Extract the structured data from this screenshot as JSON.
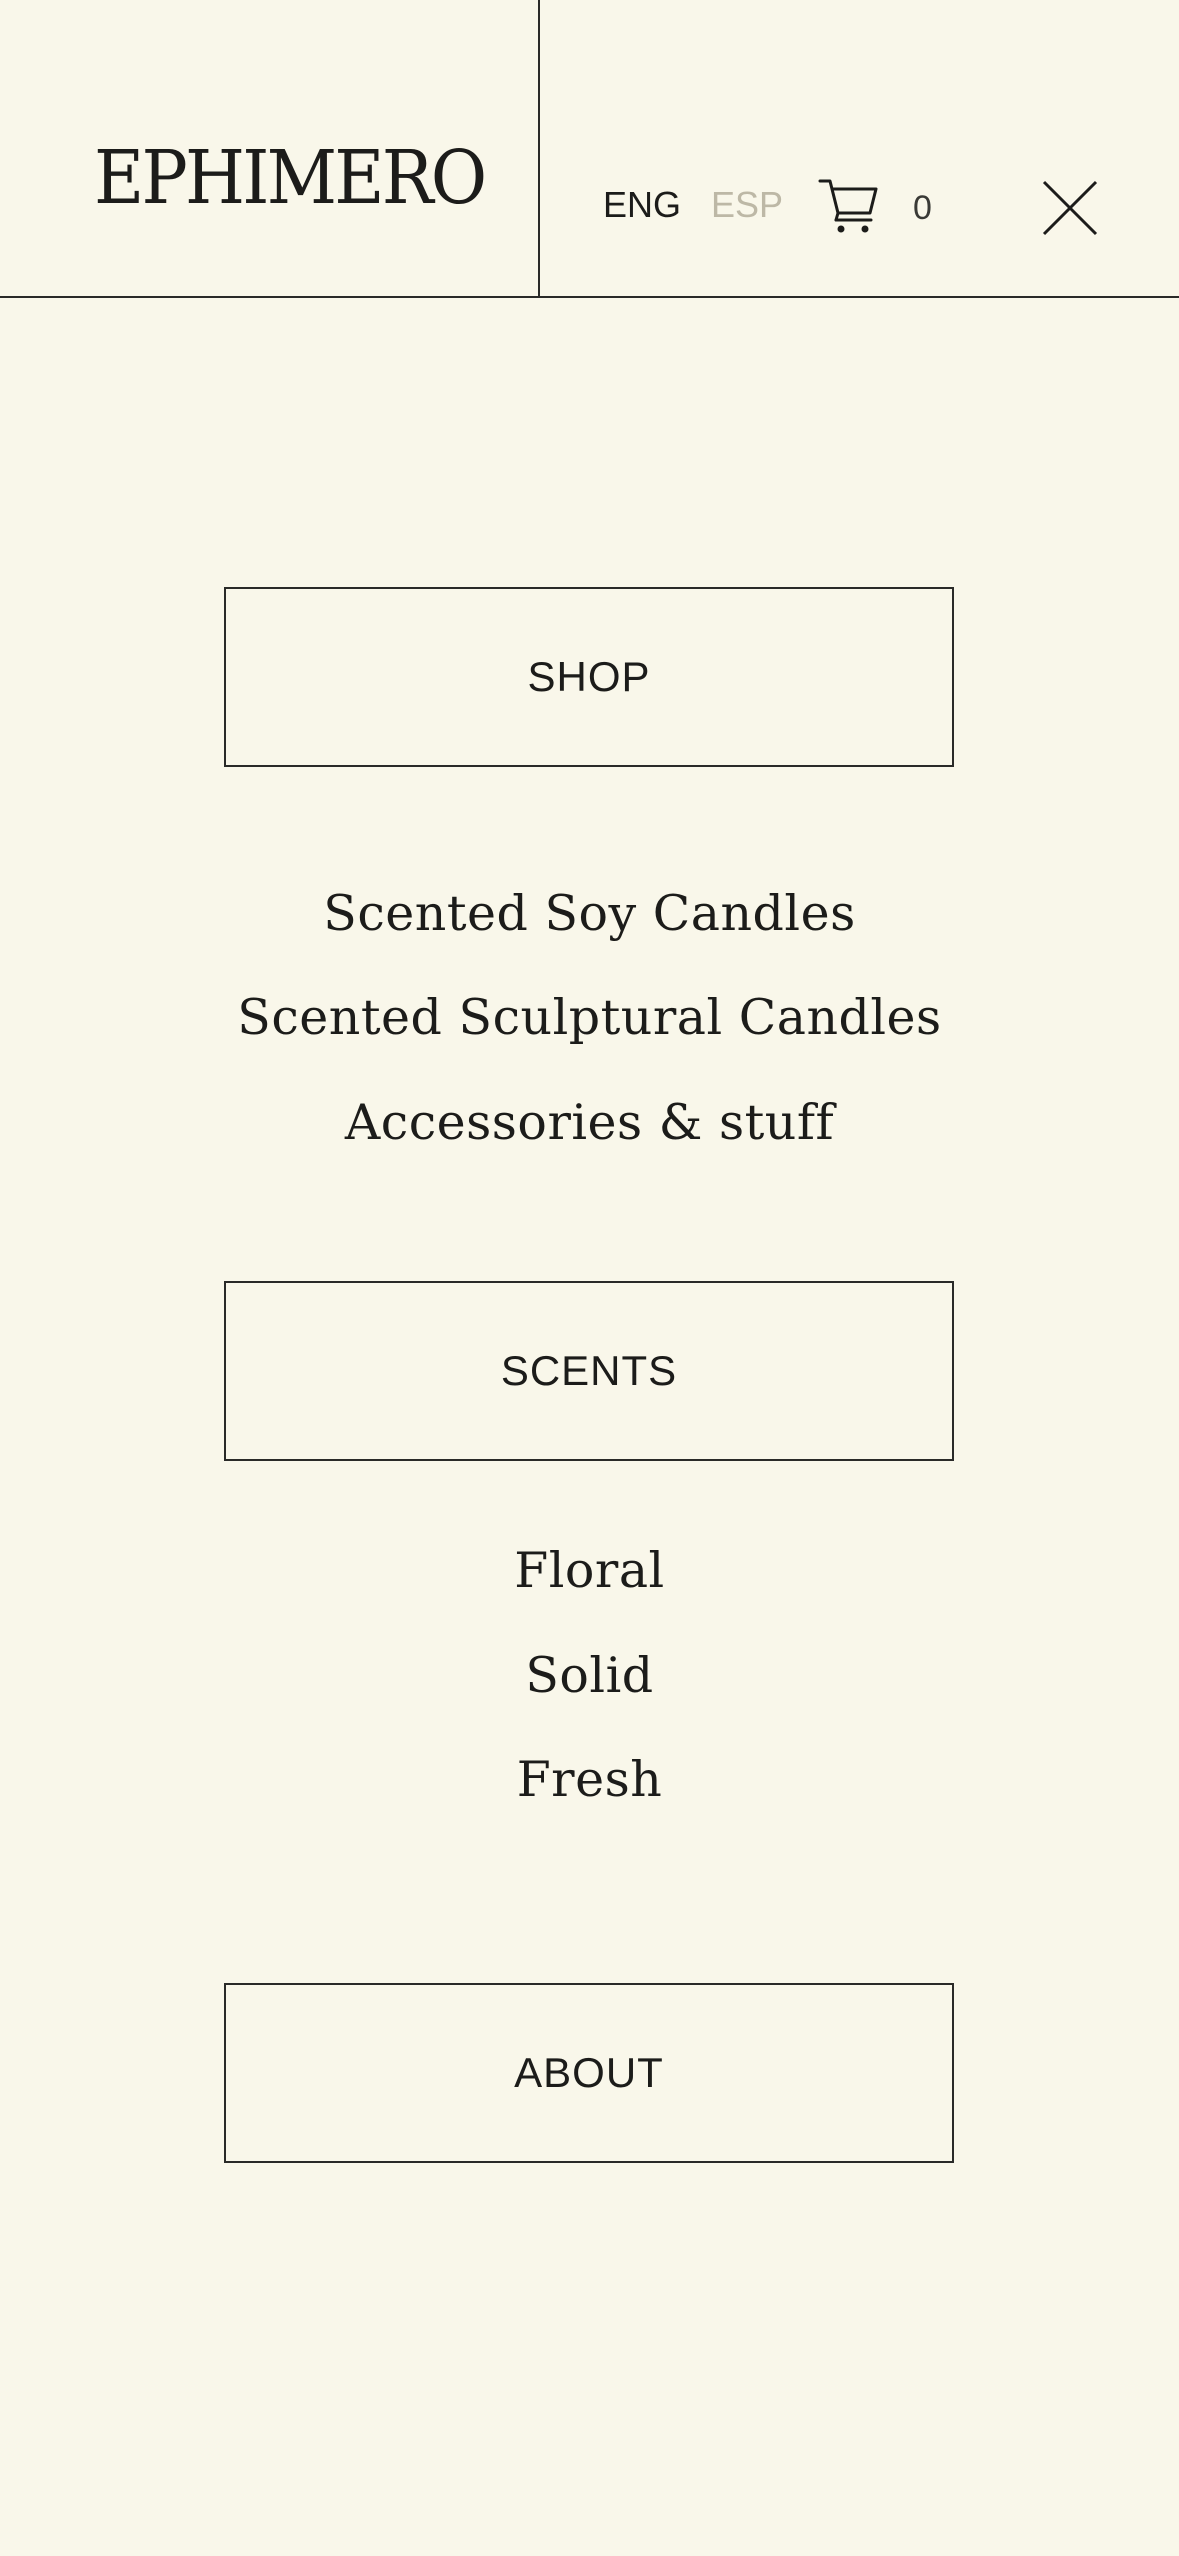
{
  "header": {
    "logo": "EPHIMERO",
    "languages": {
      "active": "ENG",
      "inactive": "ESP"
    },
    "cart": {
      "icon": "cart-icon",
      "count": "0"
    },
    "close": {
      "icon": "close-icon"
    }
  },
  "menu": {
    "shop": {
      "label": "SHOP",
      "items": [
        "Scented Soy Candles",
        "Scented Sculptural Candles",
        "Accessories & stuff"
      ]
    },
    "scents": {
      "label": "SCENTS",
      "items": [
        "Floral",
        "Solid",
        "Fresh"
      ]
    },
    "about": {
      "label": "ABOUT"
    }
  },
  "colors": {
    "background": "#f9f7ea",
    "text": "#1c1c1a",
    "inactive_language": "#bdb8a6",
    "border": "#2a2a28"
  }
}
